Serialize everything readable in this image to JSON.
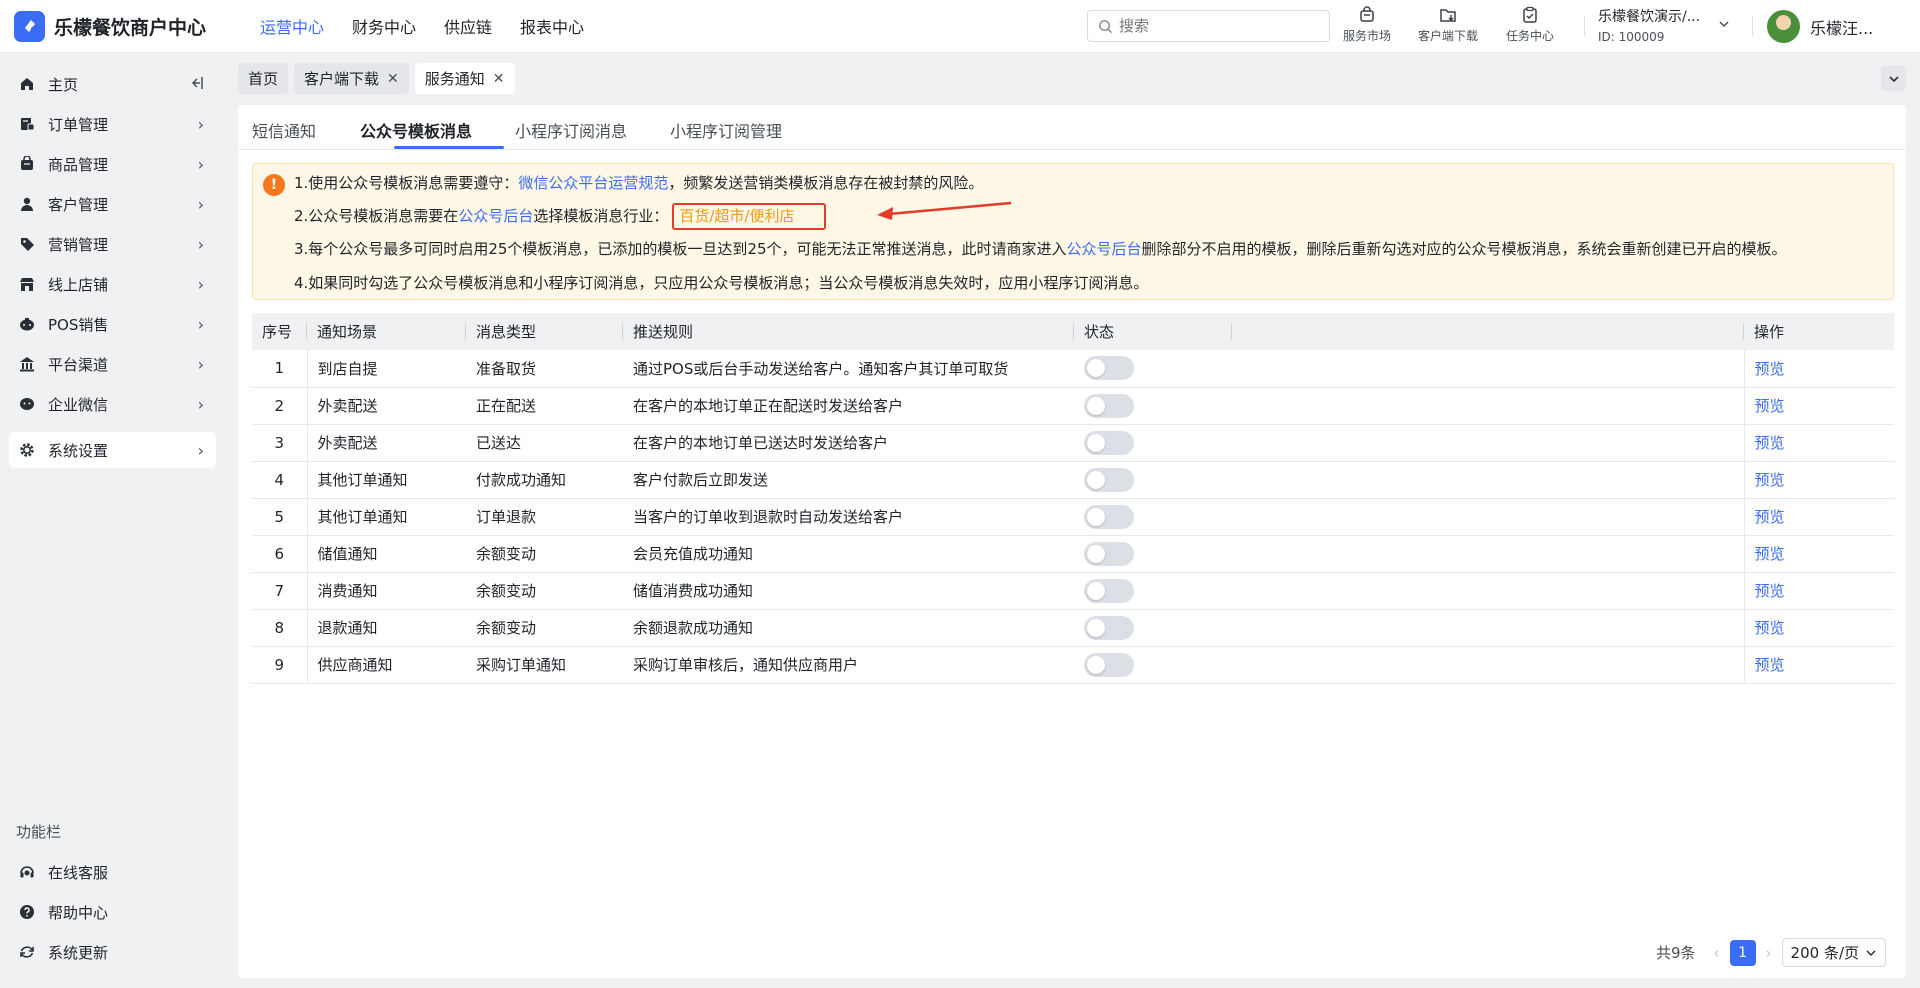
{
  "brand": {
    "name": "乐檬餐饮商户中心",
    "logo_color": "#3b6cf6"
  },
  "top_nav": [
    {
      "label": "运营中心",
      "active": true
    },
    {
      "label": "财务中心",
      "active": false
    },
    {
      "label": "供应链",
      "active": false
    },
    {
      "label": "报表中心",
      "active": false
    }
  ],
  "search": {
    "placeholder": "搜索"
  },
  "tools": [
    {
      "label": "服务市场",
      "icon": "store-icon"
    },
    {
      "label": "客户端下载",
      "icon": "download-icon"
    },
    {
      "label": "任务中心",
      "icon": "task-icon"
    }
  ],
  "account": {
    "name": "乐檬餐饮演示/...",
    "id": "ID: 100009"
  },
  "user": {
    "name": "乐檬汪..."
  },
  "sidebar": {
    "items": [
      {
        "label": "主页",
        "icon": "home-icon"
      },
      {
        "label": "订单管理",
        "icon": "order-icon"
      },
      {
        "label": "商品管理",
        "icon": "goods-icon"
      },
      {
        "label": "客户管理",
        "icon": "customer-icon"
      },
      {
        "label": "营销管理",
        "icon": "tag-icon"
      },
      {
        "label": "线上店铺",
        "icon": "shop-icon"
      },
      {
        "label": "POS销售",
        "icon": "pos-icon"
      },
      {
        "label": "平台渠道",
        "icon": "bank-icon"
      },
      {
        "label": "企业微信",
        "icon": "wechat-icon"
      },
      {
        "label": "系统设置",
        "icon": "gear-icon",
        "active": true
      }
    ],
    "func_title": "功能栏",
    "func_items": [
      {
        "label": "在线客服",
        "icon": "headset-icon"
      },
      {
        "label": "帮助中心",
        "icon": "help-icon"
      },
      {
        "label": "系统更新",
        "icon": "refresh-icon"
      }
    ]
  },
  "page_tabs": [
    {
      "label": "首页",
      "closable": false
    },
    {
      "label": "客户端下载",
      "closable": true
    },
    {
      "label": "服务通知",
      "closable": true,
      "active": true
    }
  ],
  "sub_tabs": [
    {
      "label": "短信通知"
    },
    {
      "label": "公众号模板消息",
      "active": true
    },
    {
      "label": "小程序订阅消息"
    },
    {
      "label": "小程序订阅管理"
    }
  ],
  "notice": {
    "line1_prefix": "1.使用公众号模板消息需要遵守：",
    "line1_link": "微信公众平台运营规范",
    "line1_suffix": "，频繁发送营销类模板消息存在被封禁的风险。",
    "line2_prefix": "2.公众号模板消息需要在",
    "line2_link": "公众号后台",
    "line2_mid": "选择模板消息行业：",
    "line2_industry": "百货/超市/便利店",
    "line3_prefix": "3.每个公众号最多可同时启用25个模板消息，已添加的模板一旦达到25个，可能无法正常推送消息，此时请商家进入",
    "line3_link": "公众号后台",
    "line3_suffix": "删除部分不启用的模板，删除后重新勾选对应的公众号模板消息，系统会重新创建已开启的模板。",
    "line4": "4.如果同时勾选了公众号模板消息和小程序订阅消息，只应用公众号模板消息；当公众号模板消息失效时，应用小程序订阅消息。"
  },
  "table": {
    "headers": {
      "no": "序号",
      "scene": "通知场景",
      "type": "消息类型",
      "rule": "推送规则",
      "status": "状态",
      "action": "操作"
    },
    "rows": [
      {
        "no": "1",
        "scene": "到店自提",
        "type": "准备取货",
        "rule": "通过POS或后台手动发送给客户。通知客户其订单可取货",
        "on": false,
        "action": "预览"
      },
      {
        "no": "2",
        "scene": "外卖配送",
        "type": "正在配送",
        "rule": "在客户的本地订单正在配送时发送给客户",
        "on": false,
        "action": "预览"
      },
      {
        "no": "3",
        "scene": "外卖配送",
        "type": "已送达",
        "rule": "在客户的本地订单已送达时发送给客户",
        "on": false,
        "action": "预览"
      },
      {
        "no": "4",
        "scene": "其他订单通知",
        "type": "付款成功通知",
        "rule": "客户付款后立即发送",
        "on": false,
        "action": "预览"
      },
      {
        "no": "5",
        "scene": "其他订单通知",
        "type": "订单退款",
        "rule": "当客户的订单收到退款时自动发送给客户",
        "on": false,
        "action": "预览"
      },
      {
        "no": "6",
        "scene": "储值通知",
        "type": "余额变动",
        "rule": "会员充值成功通知",
        "on": false,
        "action": "预览"
      },
      {
        "no": "7",
        "scene": "消费通知",
        "type": "余额变动",
        "rule": "储值消费成功通知",
        "on": false,
        "action": "预览"
      },
      {
        "no": "8",
        "scene": "退款通知",
        "type": "余额变动",
        "rule": "余额退款成功通知",
        "on": false,
        "action": "预览"
      },
      {
        "no": "9",
        "scene": "供应商通知",
        "type": "采购订单通知",
        "rule": "采购订单审核后，通知供应商用户",
        "on": false,
        "action": "预览"
      }
    ]
  },
  "pagination": {
    "total": "共9条",
    "current": "1",
    "page_size": "200 条/页"
  }
}
